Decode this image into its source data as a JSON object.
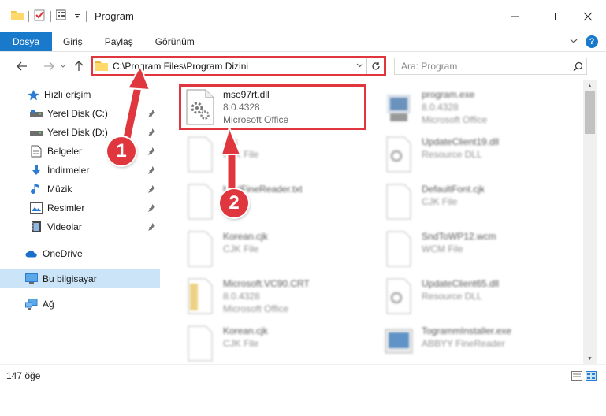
{
  "window": {
    "title": "Program",
    "minimize": "—",
    "maximize": "☐",
    "close": "✕"
  },
  "ribbon": {
    "tabs": [
      {
        "label": "Dosya",
        "active": true
      },
      {
        "label": "Giriş"
      },
      {
        "label": "Paylaş"
      },
      {
        "label": "Görünüm"
      }
    ],
    "help": "?",
    "expand": "∨"
  },
  "navigation": {
    "back": "←",
    "forward": "→",
    "recent": "∨",
    "up": "↑",
    "address_path": "C:\\Program Files\\Program Dizini",
    "address_dropdown": "∨",
    "refresh": "↻",
    "search_placeholder": "Ara: Program"
  },
  "sidebar": {
    "items": [
      {
        "label": "Hızlı erişim",
        "icon": "star-icon",
        "pinned": false
      },
      {
        "label": "Yerel Disk (C:)",
        "icon": "drive-icon",
        "pinned": true
      },
      {
        "label": "Yerel Disk (D:)",
        "icon": "drive-icon",
        "pinned": true
      },
      {
        "label": "Belgeler",
        "icon": "documents-icon",
        "pinned": true
      },
      {
        "label": "İndirmeler",
        "icon": "downloads-icon",
        "pinned": true
      },
      {
        "label": "Müzik",
        "icon": "music-icon",
        "pinned": true
      },
      {
        "label": "Resimler",
        "icon": "pictures-icon",
        "pinned": true
      },
      {
        "label": "Videolar",
        "icon": "videos-icon",
        "pinned": true
      },
      {
        "label": "OneDrive",
        "icon": "onedrive-icon",
        "pinned": false
      },
      {
        "label": "Bu bilgisayar",
        "icon": "computer-icon",
        "pinned": false,
        "selected": true
      },
      {
        "label": "Ağ",
        "icon": "network-icon",
        "pinned": false
      }
    ]
  },
  "files": [
    {
      "name": "mso97rt.dll",
      "line2": "8.0.4328",
      "line3": "Microsoft Office",
      "icon": "dll-gear-icon",
      "highlighted": true
    },
    {
      "name": "program.exe",
      "line2": "8.0.4328",
      "line3": "Microsoft Office",
      "icon": "exe-icon"
    },
    {
      "name": "...jk",
      "line2": "CJK File",
      "line3": "",
      "icon": "file-icon"
    },
    {
      "name": "UpdateClient19.dll",
      "line2": "Resource DLL",
      "line3": "",
      "icon": "dll-gear-icon"
    },
    {
      "name": "htmlFineReader.txt",
      "line2": "",
      "line3": "",
      "icon": "file-icon"
    },
    {
      "name": "DefaultFont.cjk",
      "line2": "CJK File",
      "line3": "",
      "icon": "file-icon"
    },
    {
      "name": "Korean.cjk",
      "line2": "CJK File",
      "line3": "",
      "icon": "file-icon"
    },
    {
      "name": "SndToWP12.wcm",
      "line2": "WCM File",
      "line3": "",
      "icon": "file-icon"
    },
    {
      "name": "Microsoft.VC90.CRT",
      "line2": "8.0.4328",
      "line3": "Microsoft Office",
      "icon": "manifest-icon"
    },
    {
      "name": "UpdateClient65.dll",
      "line2": "Resource DLL",
      "line3": "",
      "icon": "dll-gear-icon"
    },
    {
      "name": "Korean.cjk",
      "line2": "CJK File",
      "line3": "",
      "icon": "file-icon"
    },
    {
      "name": "TogrammInstaller.exe",
      "line2": "ABBYY FineReader",
      "line3": "",
      "icon": "installer-icon"
    }
  ],
  "status": {
    "item_count": "147 öğe"
  },
  "annotations": {
    "step1": "1",
    "step2": "2",
    "color": "#e0373f"
  },
  "colors": {
    "accent": "#1979ca",
    "highlight": "#e0373f",
    "selected": "#cce4f7"
  }
}
